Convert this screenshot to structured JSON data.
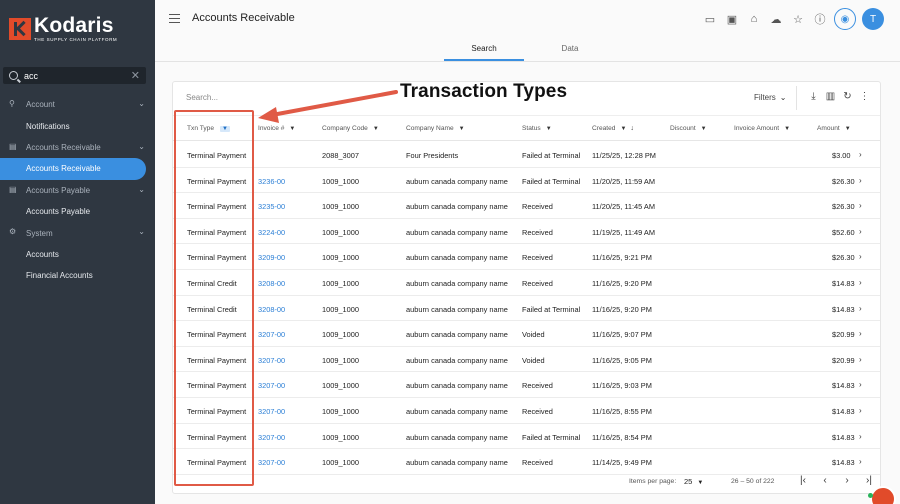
{
  "brand": {
    "name": "Kodaris",
    "tagline": "THE SUPPLY CHAIN PLATFORM",
    "accent": "#e14b2a"
  },
  "sidebar": {
    "search_value": "acc",
    "items": [
      {
        "type": "group",
        "label": "Account",
        "icon": "person-icon"
      },
      {
        "type": "sub",
        "label": "Notifications"
      },
      {
        "type": "group",
        "label": "Accounts Receivable",
        "icon": "receipt-icon"
      },
      {
        "type": "sub",
        "label": "Accounts Receivable",
        "active": true
      },
      {
        "type": "group",
        "label": "Accounts Payable",
        "icon": "receipt-icon"
      },
      {
        "type": "sub",
        "label": "Accounts Payable"
      },
      {
        "type": "group",
        "label": "System",
        "icon": "gear-icon"
      },
      {
        "type": "sub",
        "label": "Accounts"
      },
      {
        "type": "sub",
        "label": "Financial Accounts"
      }
    ]
  },
  "header": {
    "title": "Accounts Receivable",
    "avatar_initial": "T"
  },
  "tabs": [
    {
      "label": "Search",
      "active": true
    },
    {
      "label": "Data",
      "active": false
    }
  ],
  "toolbar": {
    "search_placeholder": "Search...",
    "filters_label": "Filters"
  },
  "table": {
    "columns": [
      "Txn Type",
      "Invoice #",
      "Company Code",
      "Company Name",
      "Status",
      "Created",
      "Discount",
      "Invoice Amount",
      "Amount"
    ],
    "rows": [
      [
        "Terminal Payment",
        "",
        "2088_3007",
        "Four Presidents",
        "Failed at Terminal",
        "11/25/25, 12:28 PM",
        "",
        "",
        "$3.00"
      ],
      [
        "Terminal Payment",
        "3236-00",
        "1009_1000",
        "auburn canada company name",
        "Failed at Terminal",
        "11/20/25, 11:59 AM",
        "",
        "",
        "$26.30"
      ],
      [
        "Terminal Payment",
        "3235-00",
        "1009_1000",
        "auburn canada company name",
        "Received",
        "11/20/25, 11:45 AM",
        "",
        "",
        "$26.30"
      ],
      [
        "Terminal Payment",
        "3224-00",
        "1009_1000",
        "auburn canada company name",
        "Received",
        "11/19/25, 11:49 AM",
        "",
        "",
        "$52.60"
      ],
      [
        "Terminal Payment",
        "3209-00",
        "1009_1000",
        "auburn canada company name",
        "Received",
        "11/16/25, 9:21 PM",
        "",
        "",
        "$26.30"
      ],
      [
        "Terminal Credit",
        "3208-00",
        "1009_1000",
        "auburn canada company name",
        "Received",
        "11/16/25, 9:20 PM",
        "",
        "",
        "$14.83"
      ],
      [
        "Terminal Credit",
        "3208-00",
        "1009_1000",
        "auburn canada company name",
        "Failed at Terminal",
        "11/16/25, 9:20 PM",
        "",
        "",
        "$14.83"
      ],
      [
        "Terminal Payment",
        "3207-00",
        "1009_1000",
        "auburn canada company name",
        "Voided",
        "11/16/25, 9:07 PM",
        "",
        "",
        "$20.99"
      ],
      [
        "Terminal Payment",
        "3207-00",
        "1009_1000",
        "auburn canada company name",
        "Voided",
        "11/16/25, 9:05 PM",
        "",
        "",
        "$20.99"
      ],
      [
        "Terminal Payment",
        "3207-00",
        "1009_1000",
        "auburn canada company name",
        "Received",
        "11/16/25, 9:03 PM",
        "",
        "",
        "$14.83"
      ],
      [
        "Terminal Payment",
        "3207-00",
        "1009_1000",
        "auburn canada company name",
        "Received",
        "11/16/25, 8:55 PM",
        "",
        "",
        "$14.83"
      ],
      [
        "Terminal Payment",
        "3207-00",
        "1009_1000",
        "auburn canada company name",
        "Failed at Terminal",
        "11/16/25, 8:54 PM",
        "",
        "",
        "$14.83"
      ],
      [
        "Terminal Payment",
        "3207-00",
        "1009_1000",
        "auburn canada company name",
        "Received",
        "11/14/25, 9:49 PM",
        "",
        "",
        "$14.83"
      ]
    ]
  },
  "pager": {
    "items_per_page_label": "Items per page:",
    "items_per_page": "25",
    "range": "26 – 50 of 222"
  },
  "annotation": {
    "label": "Transaction Types",
    "color": "#e05a46"
  }
}
